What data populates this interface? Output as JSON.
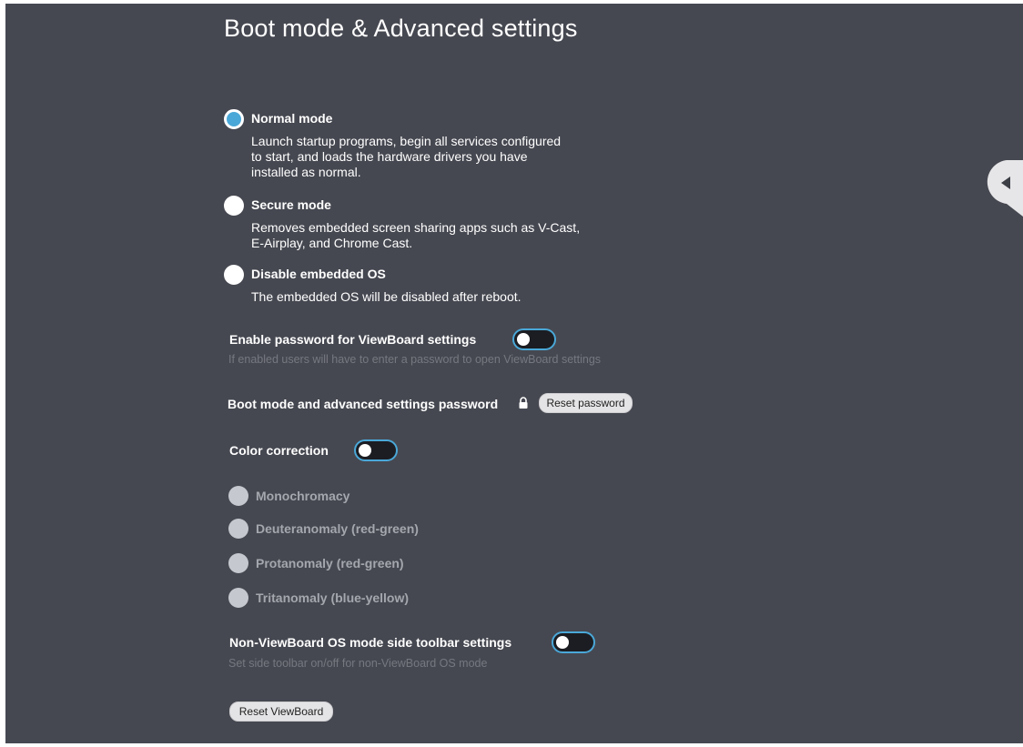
{
  "page": {
    "title": "Boot mode & Advanced settings"
  },
  "boot_modes": [
    {
      "label": "Normal mode",
      "selected": true,
      "description_lines": [
        "Launch startup programs, begin all services configured",
        "to start, and loads the hardware drivers you have",
        "installed as normal."
      ]
    },
    {
      "label": "Secure mode",
      "selected": false,
      "description_lines": [
        "Removes embedded screen sharing apps such as V-Cast,",
        "E-Airplay, and Chrome Cast."
      ]
    },
    {
      "label": "Disable embedded OS",
      "selected": false,
      "description_lines": [
        "The embedded OS will be disabled after reboot."
      ]
    }
  ],
  "password_setting": {
    "label": "Enable password for ViewBoard settings",
    "enabled": false,
    "hint": "If enabled users will have to enter a password to open ViewBoard settings"
  },
  "password_reset": {
    "label": "Boot mode and advanced settings password",
    "icon": "lock-icon",
    "button_label": "Reset password"
  },
  "color_correction": {
    "label": "Color correction",
    "enabled": false,
    "options": [
      "Monochromacy",
      "Deuteranomaly (red-green)",
      "Protanomaly (red-green)",
      "Tritanomaly (blue-yellow)"
    ]
  },
  "toolbar_setting": {
    "label": "Non-ViewBoard OS mode side toolbar settings",
    "enabled": false,
    "hint": "Set side toolbar on/off for non-ViewBoard OS mode"
  },
  "reset_button": {
    "label": "Reset ViewBoard"
  },
  "side_panel": {
    "icon": "collapse-arrow-icon"
  },
  "colors": {
    "background": "#464851",
    "accent": "#4aa8d8",
    "text": "#ffffff",
    "hint": "#767880",
    "disabled": "#a5a7ae"
  }
}
